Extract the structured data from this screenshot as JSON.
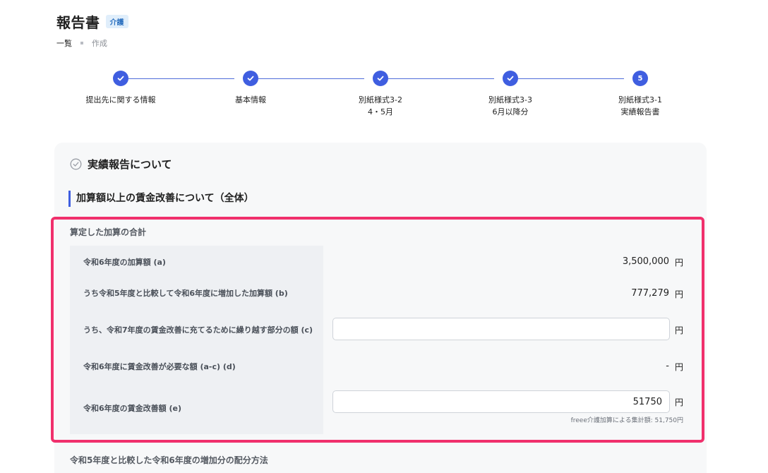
{
  "header": {
    "title": "報告書",
    "badge": "介護"
  },
  "breadcrumb": {
    "list": "一覧",
    "current": "作成"
  },
  "stepper": {
    "steps": [
      {
        "label_line1": "提出先に関する情報",
        "label_line2": "",
        "state": "done"
      },
      {
        "label_line1": "基本情報",
        "label_line2": "",
        "state": "done"
      },
      {
        "label_line1": "別紙様式3-2",
        "label_line2": "4・5月",
        "state": "done"
      },
      {
        "label_line1": "別紙様式3-3",
        "label_line2": "6月以降分",
        "state": "done"
      },
      {
        "label_line1": "別紙様式3-1",
        "label_line2": "実績報告書",
        "state": "current",
        "number": "5"
      }
    ]
  },
  "card": {
    "title": "実績報告について",
    "section_heading": "加算額以上の賃金改善について（全体）",
    "group_title": "算定した加算の合計",
    "rows": [
      {
        "label": "令和6年度の加算額 (a)",
        "value": "3,500,000",
        "unit": "円"
      },
      {
        "label": "うち令和5年度と比較して令和6年度に増加した加算額 (b)",
        "value": "777,279",
        "unit": "円"
      },
      {
        "label": "うち、令和7年度の賃金改善に充てるために繰り越す部分の額 (c)",
        "input_value": "",
        "unit": "円"
      },
      {
        "label": "令和6年度に賃金改善が必要な額 (a-c) (d)",
        "value": "-",
        "unit": "円"
      },
      {
        "label": "令和6年度の賃金改善額 (e)",
        "input_value": "51750",
        "unit": "円",
        "hint": "freee介護加算による集計額: 51,750円"
      }
    ],
    "next_group_title": "令和5年度と比較した令和6年度の増加分の配分方法"
  },
  "colors": {
    "accent": "#3f5ee0",
    "highlight": "#f0306c"
  }
}
